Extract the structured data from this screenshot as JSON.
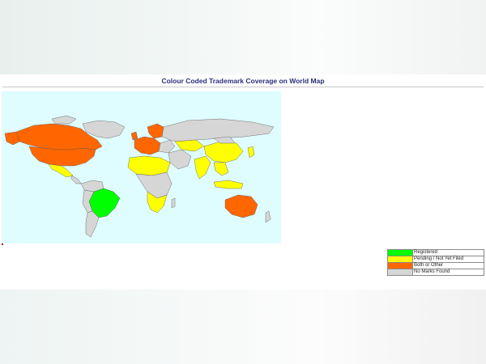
{
  "page": {
    "title": "Colour Coded Trademark Coverage on World Map"
  },
  "colors": {
    "ocean": "#dffcff",
    "registered": "#00ff00",
    "pending": "#ffff00",
    "both": "#ff6600",
    "none": "#d6d6d6"
  },
  "legend": [
    {
      "label": "Registered",
      "color": "#00ff00"
    },
    {
      "label": "Pending / Not Yet Filed",
      "color": "#ffff00"
    },
    {
      "label": "Both or Other",
      "color": "#ff6600"
    },
    {
      "label": "No Marks Found",
      "color": "#d6d6d6"
    }
  ]
}
